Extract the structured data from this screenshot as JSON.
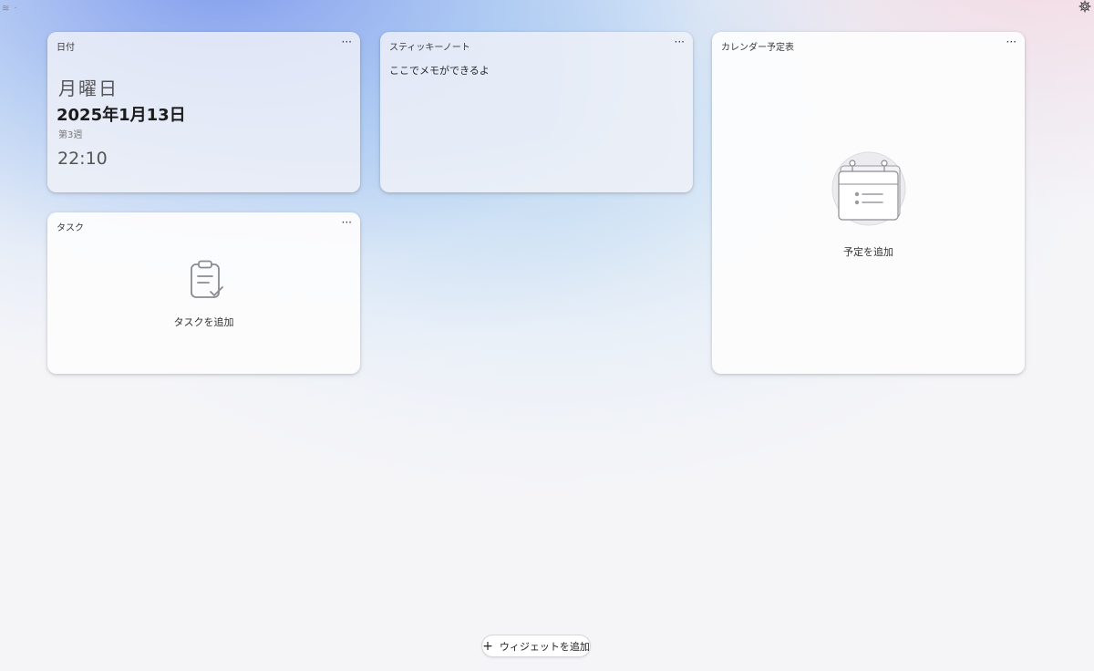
{
  "corner": {
    "left_text": "≋ ·"
  },
  "cards": {
    "date": {
      "title": "日付",
      "menu": "···",
      "weekday": "月曜日",
      "date": "2025年1月13日",
      "week": "第3週",
      "time": "22:10"
    },
    "sticky": {
      "title": "スティッキーノート",
      "menu": "···",
      "note": "ここでメモができるよ"
    },
    "calendar": {
      "title": "カレンダー予定表",
      "menu": "···",
      "add_label": "予定を追加"
    },
    "task": {
      "title": "タスク",
      "menu": "···",
      "add_label": "タスクを追加"
    }
  },
  "footer": {
    "add_widget_plus": "+",
    "add_widget_label": "ウィジェットを追加"
  },
  "icons": {
    "settings": "gear-icon",
    "calendar": "calendar-icon",
    "task": "clipboard-check-icon"
  }
}
